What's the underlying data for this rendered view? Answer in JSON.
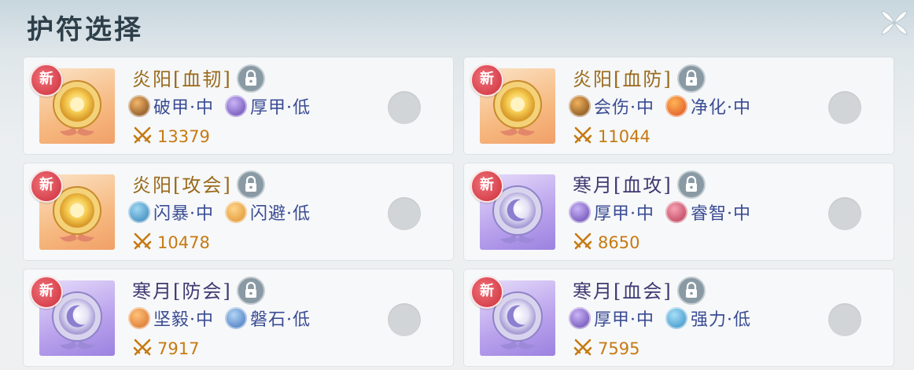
{
  "header": {
    "title": "护符选择",
    "close_icon": "close-icon"
  },
  "colors": {
    "sun_name": "#9a6a1c",
    "moon_name": "#3d3a72",
    "attr_text": "#3a4c94",
    "power": "#c67a12"
  },
  "cards": [
    {
      "badge": "新",
      "name": "炎阳[血韧]",
      "theme": "sun",
      "attrs": [
        {
          "icon": "break-armor-icon",
          "text": "破甲·中"
        },
        {
          "icon": "thick-armor-icon",
          "text": "厚甲·低"
        }
      ],
      "power": "13379"
    },
    {
      "badge": "新",
      "name": "炎阳[血防]",
      "theme": "sun",
      "attrs": [
        {
          "icon": "crit-damage-icon",
          "text": "会伤·中"
        },
        {
          "icon": "purify-icon",
          "text": "净化·中"
        }
      ],
      "power": "11044"
    },
    {
      "badge": "新",
      "name": "炎阳[攻会]",
      "theme": "sun",
      "attrs": [
        {
          "icon": "flash-burst-icon",
          "text": "闪暴·中"
        },
        {
          "icon": "dodge-icon",
          "text": "闪避·低"
        }
      ],
      "power": "10478"
    },
    {
      "badge": "新",
      "name": "寒月[血攻]",
      "theme": "moon",
      "attrs": [
        {
          "icon": "thick-armor-icon",
          "text": "厚甲·中"
        },
        {
          "icon": "wisdom-icon",
          "text": "睿智·中"
        }
      ],
      "power": "8650"
    },
    {
      "badge": "新",
      "name": "寒月[防会]",
      "theme": "moon",
      "attrs": [
        {
          "icon": "resolute-icon",
          "text": "坚毅·中"
        },
        {
          "icon": "boulder-icon",
          "text": "磐石·低"
        }
      ],
      "power": "7917"
    },
    {
      "badge": "新",
      "name": "寒月[血会]",
      "theme": "moon",
      "attrs": [
        {
          "icon": "thick-armor-icon",
          "text": "厚甲·中"
        },
        {
          "icon": "strength-icon",
          "text": "强力·低"
        }
      ],
      "power": "7595"
    }
  ]
}
